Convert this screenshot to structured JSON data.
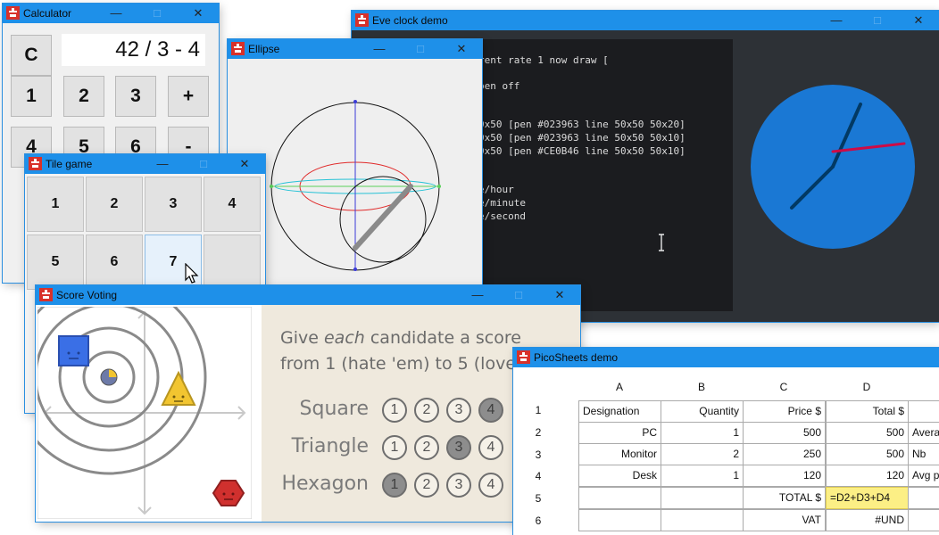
{
  "windows": {
    "calculator": {
      "title": "Calculator"
    },
    "eve": {
      "title": "Eve clock demo"
    },
    "ellipse": {
      "title": "Ellipse"
    },
    "tile": {
      "title": "Tile game"
    },
    "score": {
      "title": "Score Voting"
    },
    "pico": {
      "title": "PicoSheets demo"
    }
  },
  "controls": {
    "minimize": "—",
    "maximize": "□",
    "close": "✕"
  },
  "calculator": {
    "display": "42 / 3 - 4",
    "clear": "C",
    "keys": [
      "1",
      "2",
      "3",
      "+",
      "4",
      "5",
      "6",
      "-"
    ]
  },
  "eve": {
    "code_lines": [
      "rent rate 1 now draw [",
      "pen off",
      "0x50 [pen #023963 line 50x50 50x20]",
      "0x50 [pen #023963 line 50x50 50x10]",
      "0x50 [pen #CE0B46 line 50x50 50x10]",
      "e/hour",
      "e/minute",
      "e/second"
    ],
    "clock": {
      "face_color": "#1a78d4",
      "hand_color": "#023963",
      "second_hand_color": "#ce0b46"
    }
  },
  "tile": {
    "cells": [
      "1",
      "2",
      "3",
      "4",
      "5",
      "6",
      "7",
      ""
    ],
    "selected_value": "7"
  },
  "score": {
    "instruction_line1_a": "Give ",
    "instruction_line1_em": "each",
    "instruction_line1_b": " candidate a score",
    "instruction_line2": "from 1 (hate 'em) to 5 (love",
    "rows": [
      {
        "label": "Square",
        "selected": "4",
        "dots": [
          "1",
          "2",
          "3",
          "4"
        ]
      },
      {
        "label": "Triangle",
        "selected": "3",
        "dots": [
          "1",
          "2",
          "3",
          "4"
        ]
      },
      {
        "label": "Hexagon",
        "selected": "1",
        "dots": [
          "1",
          "2",
          "3",
          "4"
        ]
      }
    ],
    "colors": {
      "square": "#3a6fe6",
      "triangle": "#f2c530",
      "hexagon": "#d0302e"
    }
  },
  "pico": {
    "columns": [
      "A",
      "B",
      "C",
      "D"
    ],
    "rows": [
      "1",
      "2",
      "3",
      "4",
      "5",
      "6"
    ],
    "cells": {
      "A1": "Designation",
      "B1": "Quantity",
      "C1": "Price $",
      "D1": "Total $",
      "A2": "PC",
      "B2": "1",
      "C2": "500",
      "D2": "500",
      "E2": "Avera",
      "A3": "Monitor",
      "B3": "2",
      "C3": "250",
      "D3": "500",
      "E3": "Nb",
      "A4": "Desk",
      "B4": "1",
      "C4": "120",
      "D4": "120",
      "E4": "Avg p",
      "C5": "TOTAL $",
      "D5": "=D2+D3+D4",
      "C6": "VAT",
      "D6": "#UND"
    }
  }
}
